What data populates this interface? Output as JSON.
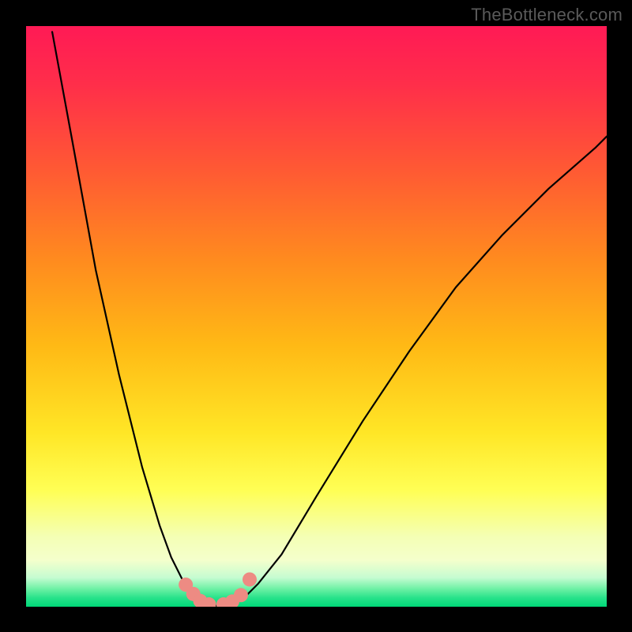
{
  "watermark": {
    "text": "TheBottleneck.com"
  },
  "colors": {
    "background_black": "#000000",
    "gradient_stops": [
      {
        "offset": 0.0,
        "color": "#ff1a55"
      },
      {
        "offset": 0.1,
        "color": "#ff2e4a"
      },
      {
        "offset": 0.25,
        "color": "#ff5a33"
      },
      {
        "offset": 0.4,
        "color": "#ff8a1f"
      },
      {
        "offset": 0.55,
        "color": "#ffb915"
      },
      {
        "offset": 0.7,
        "color": "#ffe626"
      },
      {
        "offset": 0.8,
        "color": "#ffff55"
      },
      {
        "offset": 0.88,
        "color": "#f4ffb5"
      },
      {
        "offset": 0.92,
        "color": "#f4ffcc"
      },
      {
        "offset": 0.95,
        "color": "#c5fcd1"
      },
      {
        "offset": 0.97,
        "color": "#6af0a3"
      },
      {
        "offset": 0.985,
        "color": "#26e28a"
      },
      {
        "offset": 1.0,
        "color": "#00d878"
      }
    ],
    "curve_stroke": "#000000",
    "marker_fill": "#ed8b83",
    "watermark_text": "#5a5a5a"
  },
  "chart_data": {
    "type": "line",
    "title": "",
    "xlabel": "",
    "ylabel": "",
    "xlim": [
      0,
      100
    ],
    "ylim": [
      0,
      100
    ],
    "grid": false,
    "legend": false,
    "series": [
      {
        "name": "left-branch",
        "x": [
          4.5,
          8,
          12,
          16,
          20,
          23,
          25,
          27,
          28.5,
          29.5,
          30.2
        ],
        "y": [
          99,
          80,
          58,
          40,
          24,
          14,
          8.5,
          4.5,
          2.5,
          1.2,
          0.6
        ]
      },
      {
        "name": "valley",
        "x": [
          30.2,
          31,
          32,
          33,
          34,
          35,
          36
        ],
        "y": [
          0.6,
          0.3,
          0.2,
          0.18,
          0.2,
          0.3,
          0.6
        ]
      },
      {
        "name": "right-branch",
        "x": [
          36,
          37.5,
          40,
          44,
          50,
          58,
          66,
          74,
          82,
          90,
          98,
          100
        ],
        "y": [
          0.6,
          1.5,
          4,
          9,
          19,
          32,
          44,
          55,
          64,
          72,
          79,
          81
        ]
      }
    ],
    "markers": {
      "name": "highlighted-points",
      "points": [
        {
          "x": 27.5,
          "y": 3.8
        },
        {
          "x": 28.8,
          "y": 2.2
        },
        {
          "x": 30.0,
          "y": 1.0
        },
        {
          "x": 31.5,
          "y": 0.4
        },
        {
          "x": 34.0,
          "y": 0.4
        },
        {
          "x": 35.5,
          "y": 0.9
        },
        {
          "x": 37.0,
          "y": 2.0
        },
        {
          "x": 38.5,
          "y": 4.7
        }
      ]
    }
  }
}
